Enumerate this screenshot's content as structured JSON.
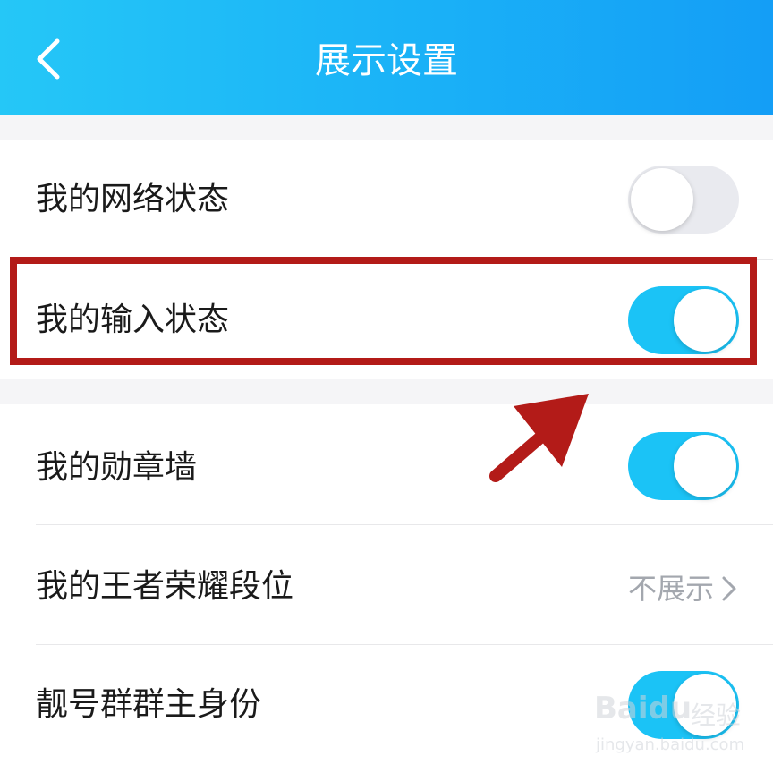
{
  "header": {
    "title": "展示设置",
    "back_icon": "chevron-left-icon",
    "gradient_colors": [
      "#25c7f7",
      "#149ef6"
    ]
  },
  "settings": {
    "network_status": {
      "label": "我的网络状态",
      "enabled": false
    },
    "input_status": {
      "label": "我的输入状态",
      "enabled": true
    },
    "badge_wall": {
      "label": "我的勋章墙",
      "enabled": true
    },
    "honor_of_kings_rank": {
      "label": "我的王者荣耀段位",
      "value": "不展示",
      "icon": "chevron-right-icon"
    },
    "group_owner_identity": {
      "label": "靓号群群主身份",
      "enabled": true
    }
  },
  "colors": {
    "accent": "#1bc3f6",
    "toggle_off": "#e9eaef",
    "annotation": "#b31b18"
  },
  "watermark": {
    "brand": "Baidu",
    "jingyan": "经验",
    "url": "jingyan.baidu.com"
  }
}
